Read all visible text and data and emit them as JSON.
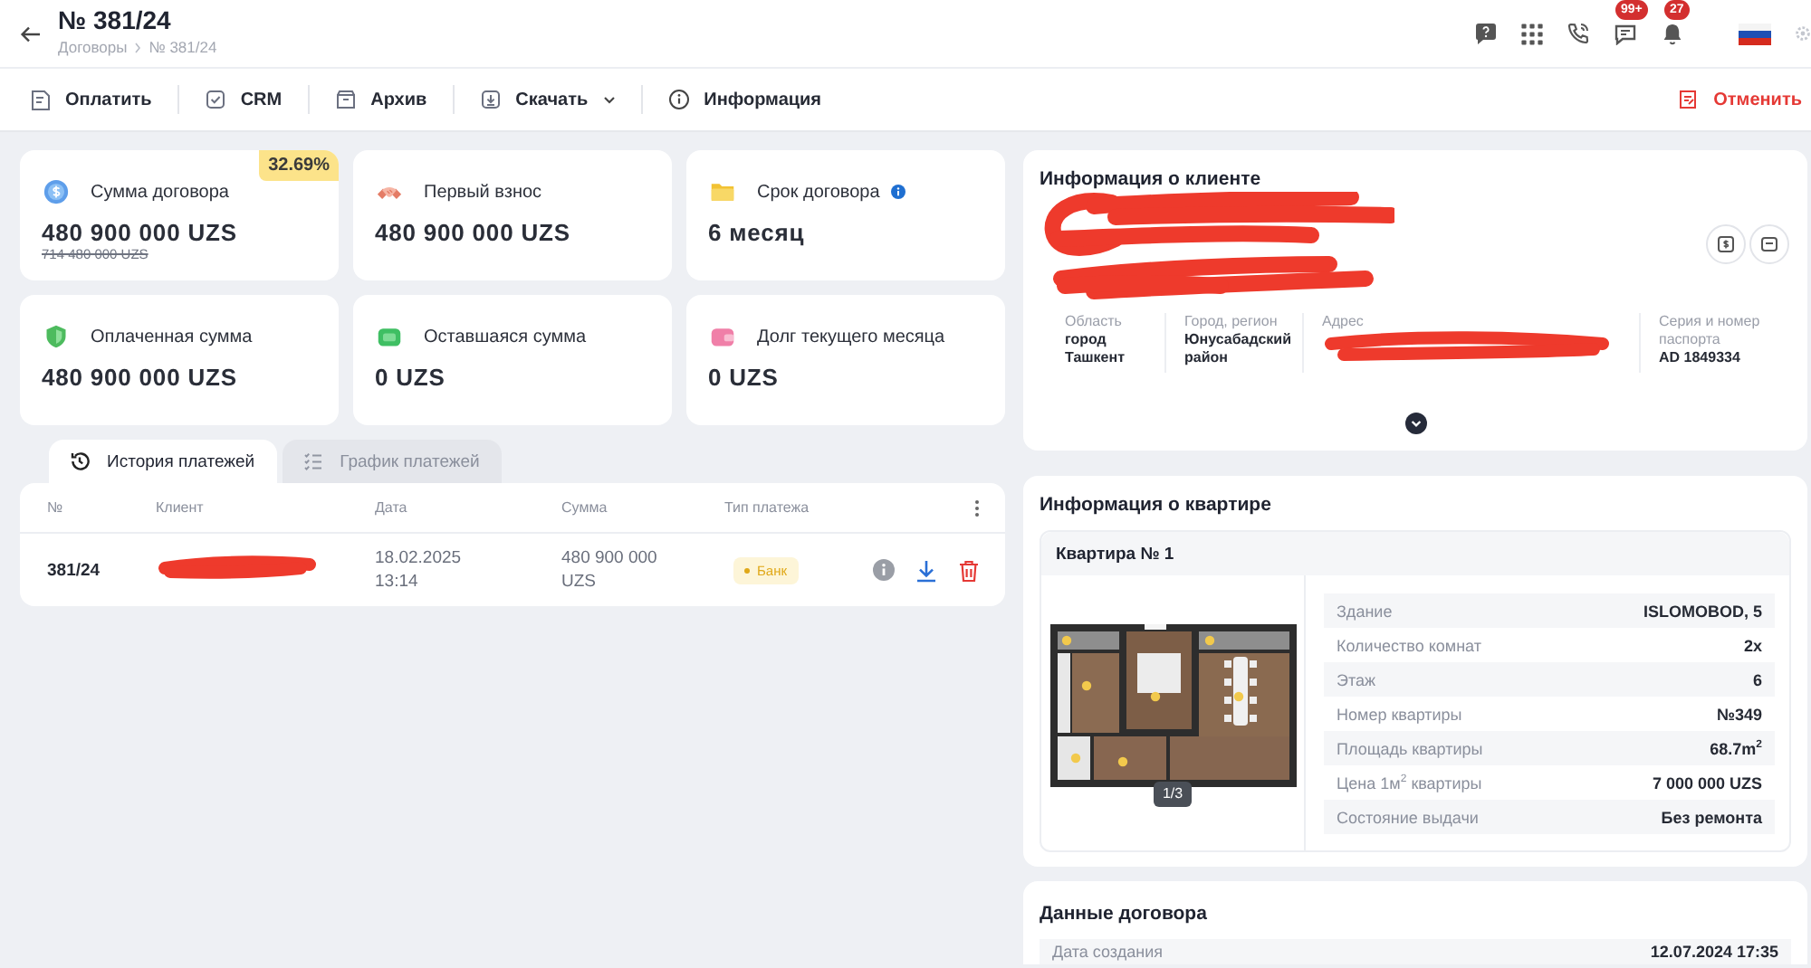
{
  "header": {
    "title": "№ 381/24",
    "breadcrumbs": [
      "Договоры",
      "№ 381/24"
    ],
    "notifications": [
      {
        "kind": "chat",
        "count": "99+"
      },
      {
        "kind": "bell",
        "count": "27"
      }
    ]
  },
  "toolbar": {
    "actions": [
      {
        "kind": "pay",
        "label": "Оплатить",
        "dropdown": false
      },
      {
        "kind": "crm",
        "label": "CRM",
        "dropdown": false
      },
      {
        "kind": "archive",
        "label": "Архив",
        "dropdown": false
      },
      {
        "kind": "download",
        "label": "Скачать",
        "dropdown": true
      },
      {
        "kind": "info",
        "label": "Информация",
        "dropdown": false
      }
    ],
    "cancel": {
      "label": "Отменить"
    }
  },
  "stats": [
    {
      "kind": "coin",
      "label": "Сумма договора",
      "value": "480 900 000 UZS",
      "old_value": "714 480 000 UZS",
      "badge": "32.69%",
      "has_info": false
    },
    {
      "kind": "handshake",
      "label": "Первый взнос",
      "value": "480 900 000 UZS",
      "has_info": false
    },
    {
      "kind": "folder",
      "label": "Срок договора",
      "value": "6 месяц",
      "has_info": true
    },
    {
      "kind": "shield",
      "label": "Оплаченная сумма",
      "value": "480 900 000 UZS",
      "has_info": false
    },
    {
      "kind": "wallet",
      "label": "Оставшаяся сумма",
      "value": "0 UZS",
      "has_info": false
    },
    {
      "kind": "card",
      "label": "Долг текущего месяца",
      "value": "0 UZS",
      "has_info": false
    }
  ],
  "payments": {
    "tabs": [
      {
        "kind": "history",
        "label": "История платежей",
        "selected": true
      },
      {
        "kind": "schedule",
        "label": "График платежей",
        "selected": false
      }
    ],
    "columns": [
      "№",
      "Клиент",
      "Дата",
      "Сумма",
      "Тип платежа"
    ],
    "rows": [
      {
        "number": "381/24",
        "datetime": "18.02.2025 13:14",
        "amount": "480 900 000 UZS",
        "type": "Банк"
      }
    ]
  },
  "client": {
    "title": "Информация о клиенте",
    "fields": [
      {
        "label": "Область",
        "value": "город Ташкент"
      },
      {
        "label": "Город, регион",
        "value": "Юнусабадский район"
      },
      {
        "label": "Адрес"
      },
      {
        "label": "Серия и номер паспорта",
        "value": "AD 1849334"
      }
    ]
  },
  "apartment": {
    "title": "Информация о квартире",
    "name": "Квартира № 1",
    "image_counter": "1/3",
    "specs": [
      {
        "label": "Здание",
        "value": "ISLOMOBOD, 5"
      },
      {
        "label": "Количество комнат",
        "value": "2x"
      },
      {
        "label": "Этаж",
        "value": "6"
      },
      {
        "label": "Номер квартиры",
        "value": "№349"
      },
      {
        "label": "Площадь квартиры",
        "value": "68.7m$^{2}$"
      },
      {
        "label": "Цена 1м$^{2}$ квартиры",
        "value": "7 000 000 UZS"
      },
      {
        "label": "Состояние выдачи",
        "value": "Без ремонта"
      }
    ]
  },
  "contract": {
    "title": "Данные договора",
    "rows": [
      {
        "label": "Дата создания",
        "value": "12.07.2024 17:35"
      }
    ]
  }
}
